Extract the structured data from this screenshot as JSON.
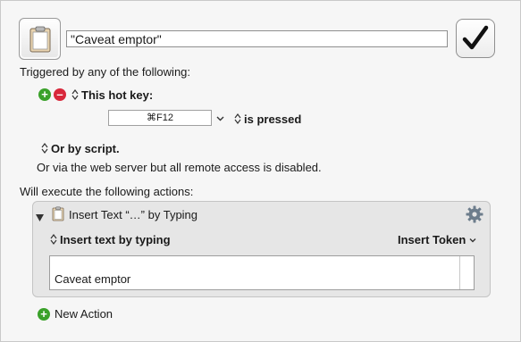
{
  "macro": {
    "name": "\"Caveat emptor\"",
    "icon": "clipboard-icon",
    "enabled_icon": "checkmark-icon"
  },
  "triggers": {
    "heading": "Triggered by any of the following:",
    "hot_key_label": "This hot key:",
    "hot_key_value": "⌘F12",
    "hot_key_state": "is pressed",
    "script_label": "Or by script.",
    "web_server_text": "Or via the web server but all remote access is disabled."
  },
  "actions": {
    "heading": "Will execute the following actions:",
    "items": [
      {
        "title": "Insert Text “…” by Typing",
        "mode": "Insert text by typing",
        "token_menu": "Insert Token",
        "text": "Caveat emptor"
      }
    ],
    "new_action_label": "New Action"
  },
  "colors": {
    "add": "#3aa12a",
    "remove": "#d8283b"
  }
}
